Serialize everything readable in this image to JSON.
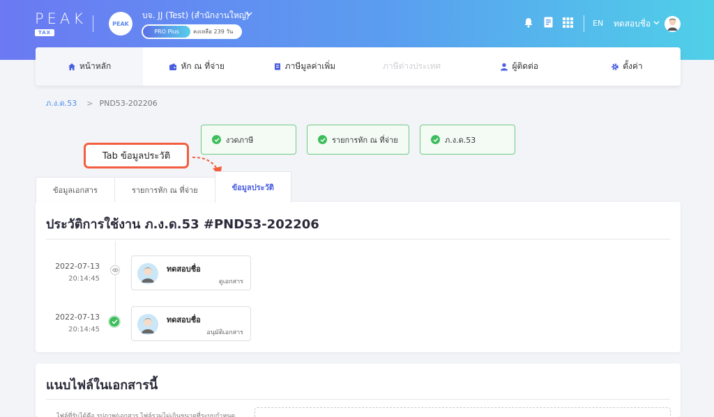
{
  "header": {
    "logo_text": "PEAK",
    "logo_badge": "TAX",
    "company_logo_text": "PEAK",
    "company_name": "บจ. JJ (Test) (สำนักงานใหญ่)",
    "plan_label": "PRO Plus",
    "plan_remaining": "คงเหลือ 239 วัน",
    "language": "EN",
    "user_name": "ทดสอบชื่อ",
    "icons": [
      "bell-icon",
      "document-icon",
      "apps-grid-icon"
    ]
  },
  "nav": {
    "items": [
      {
        "label": "หน้าหลัก",
        "icon": "home-icon"
      },
      {
        "label": "หัก ณ ที่จ่าย",
        "icon": "wallet-icon"
      },
      {
        "label": "ภาษีมูลค่าเพิ่ม",
        "icon": "receipt-icon"
      },
      {
        "label": "ภาษีต่างประเทศ",
        "icon": ""
      },
      {
        "label": "ผู้ติดต่อ",
        "icon": "person-icon"
      },
      {
        "label": "ตั้งค่า",
        "icon": "gear-icon"
      }
    ]
  },
  "breadcrumb": {
    "parent": "ภ.ง.ด.53",
    "current": "PND53-202206"
  },
  "status_steps": [
    {
      "label": "งวดภาษี"
    },
    {
      "label": "รายการหัก ณ ที่จ่าย"
    },
    {
      "label": "ภ.ง.ด.53"
    }
  ],
  "callout": {
    "text": "Tab ข้อมูลประวัติ",
    "color": "#f25e3e"
  },
  "tabs": [
    {
      "label": "ข้อมูลเอกสาร"
    },
    {
      "label": "รายการหัก ณ ที่จ่าย"
    },
    {
      "label": "ข้อมูลประวัติ"
    }
  ],
  "history": {
    "title": "ประวัติการใช้งาน ภ.ง.ด.53 #PND53-202206",
    "entries": [
      {
        "date": "2022-07-13",
        "time": "20:14:45",
        "user": "ทดสอบชื่อ",
        "action": "ดูเอกสาร",
        "marker": "eye-icon"
      },
      {
        "date": "2022-07-13",
        "time": "20:14:45",
        "user": "ทดสอบชื่อ",
        "action": "อนุมัติเอกสาร",
        "marker": "check-icon"
      }
    ]
  },
  "attachments": {
    "title": "แนบไฟล์ในเอกสารนี้",
    "description": "ไฟล์ที่รับได้คือ รูปภาพ/เอกสาร ไฟล์รวมไม่เกินขนาดที่ระบบกำหนด"
  },
  "colors": {
    "accent": "#4a5fe0",
    "success": "#3dbd5b",
    "link": "#4a8ef0"
  }
}
